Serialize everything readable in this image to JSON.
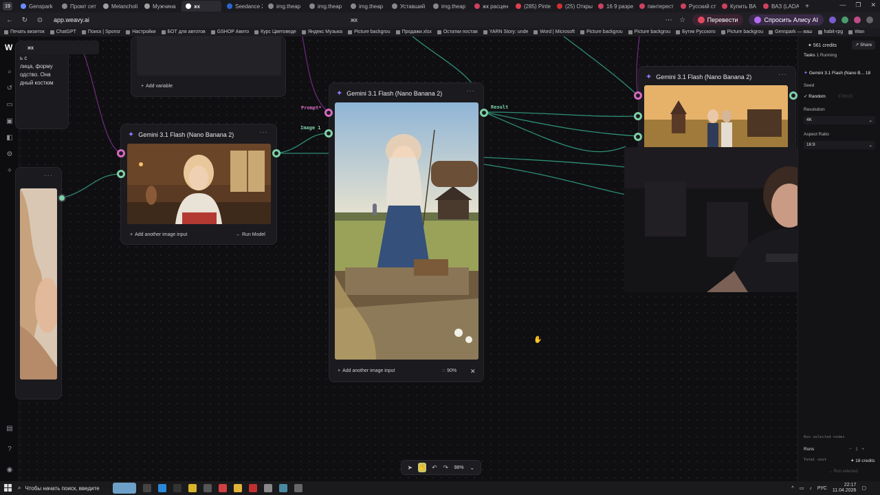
{
  "browser": {
    "tab_count": "19",
    "tabs": [
      "Genspark",
      "Промт сет",
      "Melancholi",
      "Мужчина",
      "жк",
      "Seedance 2",
      "img.theap",
      "img.theap",
      "img.theap",
      "Уставший",
      "img.theap",
      "жк расцен",
      "(285) Pinte",
      "(25) Откры",
      "16 9 разре",
      "пинтерест",
      "Русский ст",
      "Купить ВА",
      "ВАЗ (LADA"
    ],
    "active_tab_index": 4,
    "url": "app.weavy.ai",
    "page_title": "жк",
    "translate_label": "Перевести",
    "alice_label": "Спросить Алису AI",
    "bookmarks": [
      "Печать визиток",
      "ChatGPT",
      "Поиск | Sponsr",
      "Настройки",
      "БОТ для автотов",
      "GSHOP Авито",
      "Курс Цветоведе",
      "Яндекс Музыка",
      "Picture backgrou",
      "Продажи.xlsx",
      "Остатки постав",
      "YARN Story: unde",
      "Word | Microsoft",
      "Picture backgrou",
      "Picture backgrou",
      "Бутик Русского",
      "Picture backgrou",
      "Genspark — ваш",
      "habit-rpg",
      "Wan"
    ]
  },
  "canvas": {
    "project_tag": "жк",
    "left_text_fragment": [
      "ик",
      "ь с",
      "лица, форму",
      "одство. Она",
      "дный костюм"
    ],
    "var_node": {
      "add_variable": "Add variable"
    },
    "node_left": {
      "title": "Gemini 3.1 Flash (Nano Banana 2)",
      "add_input": "Add another image input",
      "run": "Run Model"
    },
    "node_center": {
      "title": "Gemini 3.1 Flash (Nano Banana 2)",
      "add_input": "Add another image input",
      "progress": "90%",
      "label_prompt": "Prompt*",
      "label_image": "Image 1",
      "label_result": "Result"
    },
    "node_right": {
      "title": "Gemini 3.1 Flash (Nano Banana 2)"
    },
    "zoom": "98%"
  },
  "right_panel": {
    "credits": "561 credits",
    "share": "Share",
    "tasks": "Tasks",
    "tasks_running": "1 Running",
    "model": "Gemini 3.1 Flash (Nano B...",
    "model_count": "18",
    "seed_label": "Seed",
    "random_label": "Random",
    "seed_value": "378020",
    "resolution_label": "Resolution",
    "resolution_value": "4K",
    "aspect_label": "Aspect Ratio",
    "aspect_value": "16:9",
    "run_selected": "Run selected nodes",
    "runs_label": "Runs",
    "runs_value": "1",
    "total_cost_label": "Total cost",
    "total_cost_value": "18 credits",
    "run_button": "Run selected"
  },
  "taskbar": {
    "search_placeholder": "Чтобы начать поиск, введите",
    "lang": "РУС",
    "time": "22:17",
    "date": "11.04.2026"
  },
  "colors": {
    "wire_green": "#2f8f74",
    "wire_purple": "#6a2a78",
    "port_green": "#7fd1a7",
    "port_pink": "#d76ac0",
    "accent_violet": "#8e7bff"
  }
}
